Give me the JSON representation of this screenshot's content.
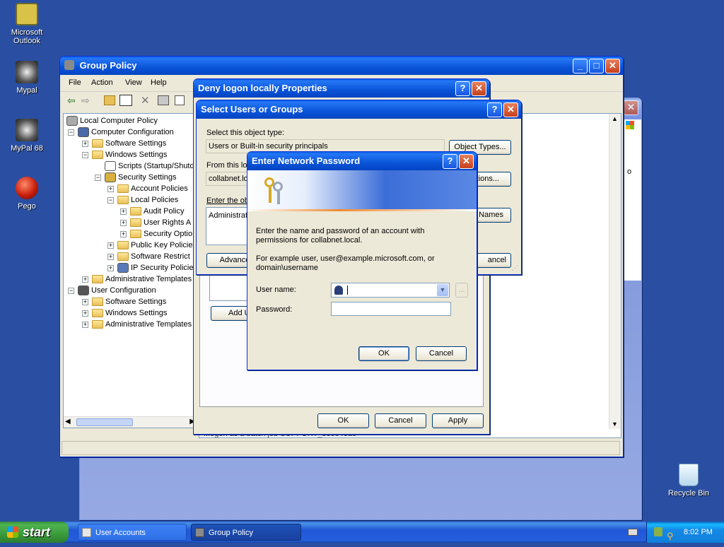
{
  "desktop": {
    "icons": [
      {
        "label": "Microsoft Outlook",
        "icon": "outlook-icon"
      },
      {
        "label": "Mypal",
        "icon": "mypal-icon"
      },
      {
        "label": "MyPal 68",
        "icon": "mypal68-icon"
      },
      {
        "label": "Pego",
        "icon": "pego-icon"
      },
      {
        "label": "Recycle Bin",
        "icon": "recycle-bin-icon"
      }
    ]
  },
  "bg_window": {
    "partial_text": "o"
  },
  "group_policy": {
    "title": "Group Policy",
    "menu": [
      "File",
      "Action",
      "View",
      "Help"
    ],
    "tree": [
      {
        "label": "Local Computer Policy",
        "level": 0
      },
      {
        "label": "Computer Configuration",
        "level": 1
      },
      {
        "label": "Software Settings",
        "level": 2
      },
      {
        "label": "Windows Settings",
        "level": 2
      },
      {
        "label": "Scripts (Startup/Shutd",
        "level": 3
      },
      {
        "label": "Security Settings",
        "level": 3
      },
      {
        "label": "Account Policies",
        "level": 4
      },
      {
        "label": "Local Policies",
        "level": 4
      },
      {
        "label": "Audit Policy",
        "level": 5
      },
      {
        "label": "User Rights A",
        "level": 5
      },
      {
        "label": "Security Optio",
        "level": 5
      },
      {
        "label": "Public Key Policies",
        "level": 4
      },
      {
        "label": "Software Restrict",
        "level": 4
      },
      {
        "label": "IP Security Policie",
        "level": 4
      },
      {
        "label": "Administrative Templates",
        "level": 2
      },
      {
        "label": "User Configuration",
        "level": 1
      },
      {
        "label": "Software Settings",
        "level": 2
      },
      {
        "label": "Windows Settings",
        "level": 2
      },
      {
        "label": "Administrative Templates",
        "level": 2
      }
    ],
    "bottom_row_partial": "...ogon as a batch job          SUPPORT_388945a0"
  },
  "deny_dialog": {
    "title": "Deny logon locally Properties",
    "add_button": "Add U",
    "ok": "OK",
    "cancel": "Cancel",
    "apply": "Apply"
  },
  "select_dialog": {
    "title": "Select Users or Groups",
    "object_type_label": "Select this object type:",
    "object_type_value": "Users or Built-in security principals",
    "object_types_button": "Object Types...",
    "location_label": "From this loca",
    "location_value": "collabnet.lo",
    "locations_button": "ations...",
    "enter_label": "Enter the ob",
    "enter_value": "Administrato",
    "check_names_button": "Names",
    "advanced_button": "Advance",
    "cancel_button": "ancel"
  },
  "pwd_dialog": {
    "title": "Enter Network Password",
    "description": "Enter the name and password of an account with permissions for collabnet.local.",
    "example": "For example user, user@example.microsoft.com, or domain\\username",
    "username_label": "User name:",
    "username_value": "",
    "password_label": "Password:",
    "password_value": "",
    "ok": "OK",
    "cancel": "Cancel"
  },
  "taskbar": {
    "start": "start",
    "tasks": [
      {
        "label": "User Accounts",
        "active": false
      },
      {
        "label": "Group Policy",
        "active": true
      }
    ],
    "time": "8:02 PM"
  },
  "colors": {
    "desktop": "#2a4fa2",
    "titlebar": "#0a54d8",
    "dialog": "#ece9d8"
  }
}
